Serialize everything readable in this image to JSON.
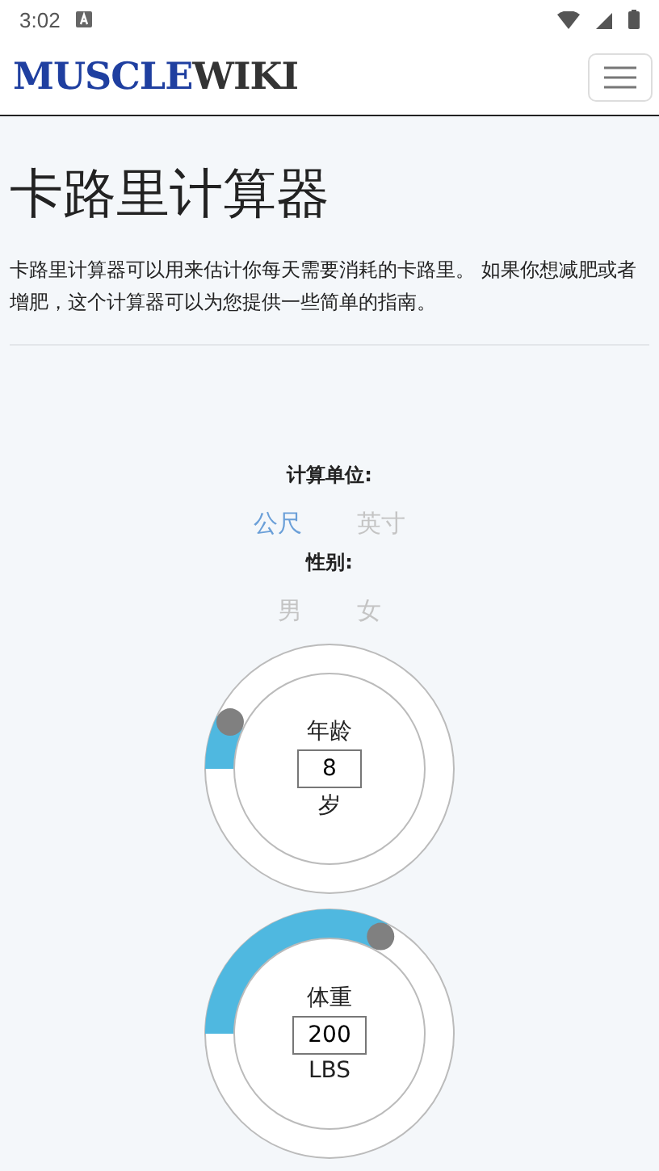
{
  "status_bar": {
    "time": "3:02"
  },
  "header": {
    "logo_main": "MUSCLE",
    "logo_accent": "WIKI"
  },
  "title": "卡路里计算器",
  "intro": "卡路里计算器可以用来估计你每天需要消耗的卡路里。 如果你想减肥或者增肥，这个计算器可以为您提供一些简单的指南。",
  "unit_label": "计算单位:",
  "units": [
    {
      "label": "公尺",
      "selected": true
    },
    {
      "label": "英寸",
      "selected": false
    }
  ],
  "gender_label": "性别:",
  "genders": [
    {
      "label": "男",
      "selected": false
    },
    {
      "label": "女",
      "selected": false
    }
  ],
  "dials": [
    {
      "label": "年龄",
      "value": "8",
      "unit": "岁"
    },
    {
      "label": "体重",
      "value": "200",
      "unit": "LBS"
    }
  ]
}
